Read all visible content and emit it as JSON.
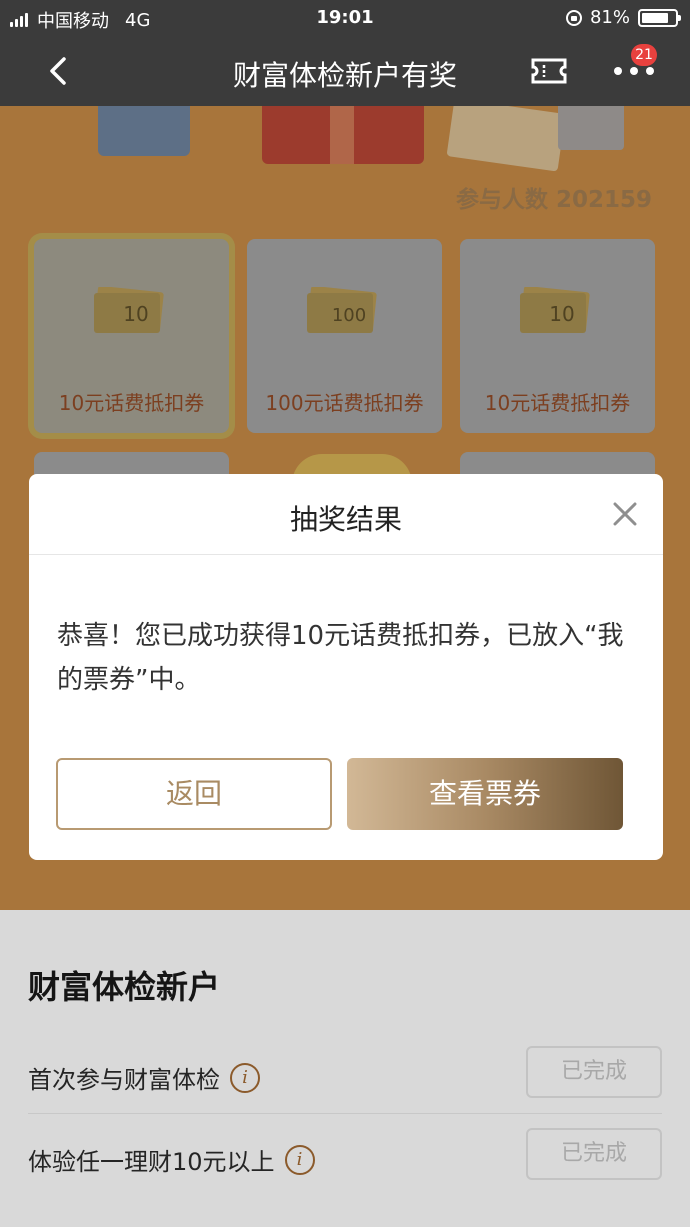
{
  "status_bar": {
    "carrier": "中国移动",
    "network": "4G",
    "time": "19:01",
    "battery_percent_label": "81%",
    "battery_level": 0.81
  },
  "nav": {
    "title": "财富体检新户有奖",
    "badge_count": "21",
    "icons": [
      "back-icon",
      "ticket-icon",
      "more-icon"
    ]
  },
  "activity": {
    "participants_label": "参与人数",
    "participants_count": "202159",
    "prizes": [
      {
        "label": "10元话费抵扣券",
        "coupon_text": "10",
        "selected": true
      },
      {
        "label": "100元话费抵扣券",
        "coupon_text": "100",
        "selected": false
      },
      {
        "label": "10元话费抵扣券",
        "coupon_text": "10",
        "selected": false
      }
    ]
  },
  "modal": {
    "title": "抽奖结果",
    "message": "恭喜！您已成功获得10元话费抵扣券，已放入“我的票券”中。",
    "back_label": "返回",
    "view_label": "查看票券"
  },
  "tasks": {
    "heading": "财富体检新户",
    "items": [
      {
        "name": "首次参与财富体检",
        "status": "已完成"
      },
      {
        "name": "体验任一理财10元以上",
        "status": "已完成"
      }
    ]
  },
  "colors": {
    "nav_bg": "#3b3b3b",
    "accent_gold": "#a98a64",
    "badge_red": "#e8413e"
  }
}
